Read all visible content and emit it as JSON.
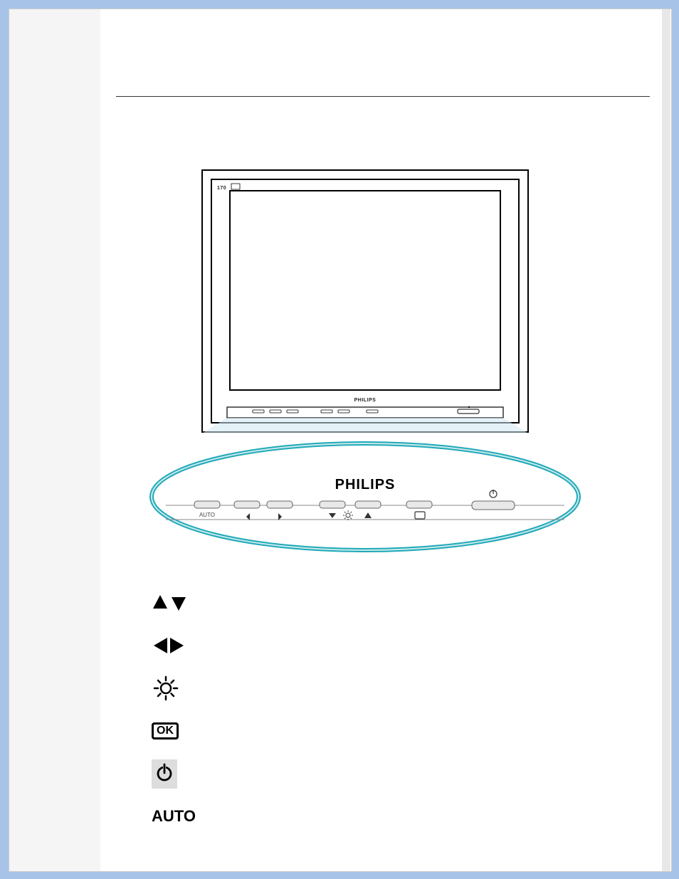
{
  "brand": "PHILIPS",
  "monitor_model_label": "170",
  "closeup": {
    "buttons": {
      "auto_label": "AUTO",
      "power_icon": "power-icon"
    }
  },
  "legend": {
    "items": [
      {
        "key": "up-down",
        "icon": "up-down-triangles"
      },
      {
        "key": "left-right",
        "icon": "left-right-triangles"
      },
      {
        "key": "brightness",
        "icon": "brightness-icon"
      },
      {
        "key": "ok",
        "icon": "ok-box",
        "label": "OK"
      },
      {
        "key": "power",
        "icon": "power-icon"
      },
      {
        "key": "auto",
        "icon": "auto-text",
        "label": "AUTO"
      }
    ]
  }
}
